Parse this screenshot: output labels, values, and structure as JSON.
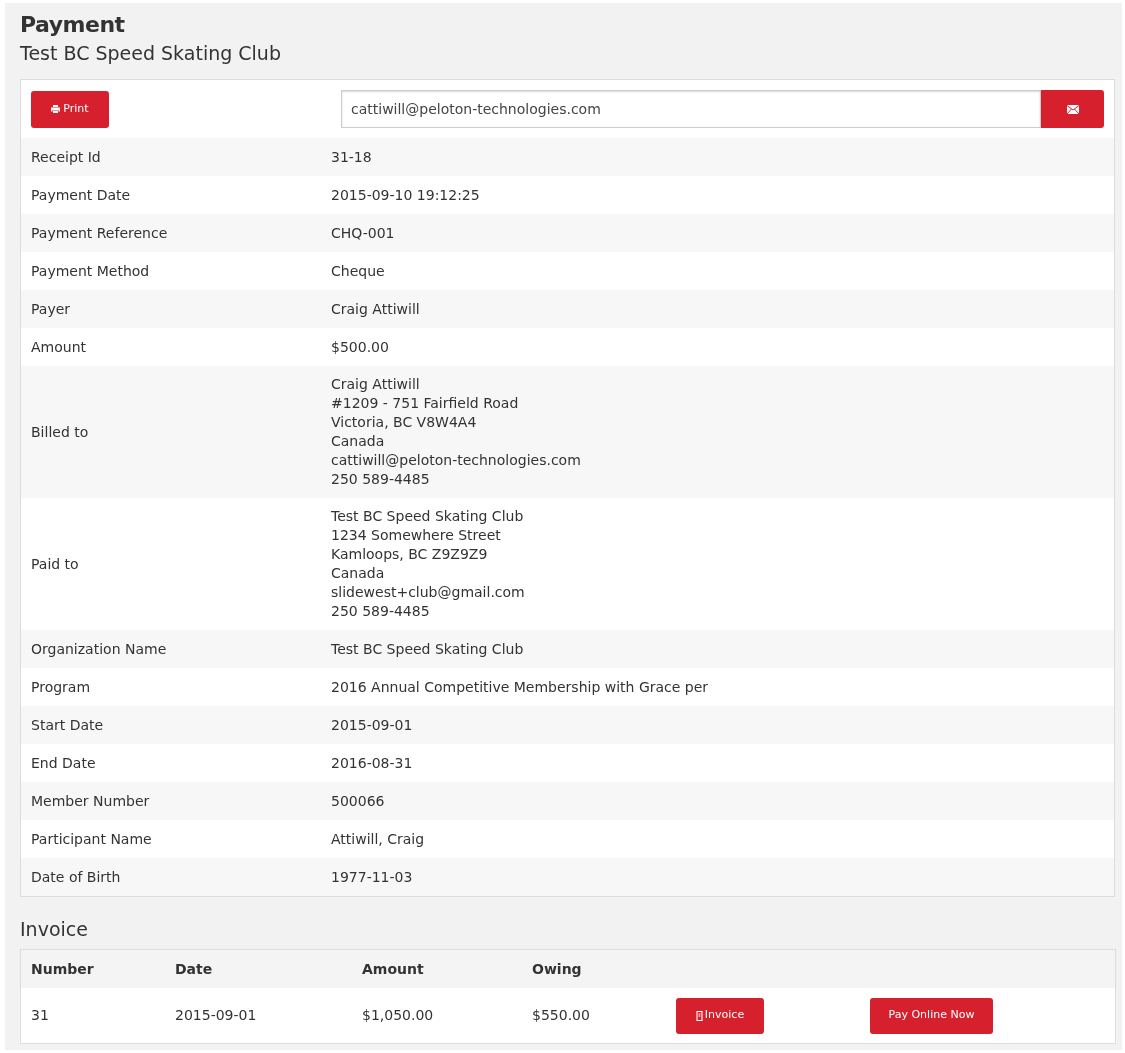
{
  "title": "Payment",
  "subtitle": "Test BC Speed Skating Club",
  "toolbar": {
    "print_button": "Print",
    "email_field": {
      "value": "cattiwill@peloton-technologies.com"
    }
  },
  "details": [
    {
      "label": "Receipt Id",
      "lines": [
        "31-18"
      ]
    },
    {
      "label": "Payment Date",
      "lines": [
        "2015-09-10 19:12:25"
      ]
    },
    {
      "label": "Payment Reference",
      "lines": [
        "CHQ-001"
      ]
    },
    {
      "label": "Payment Method",
      "lines": [
        "Cheque"
      ]
    },
    {
      "label": "Payer",
      "lines": [
        "Craig Attiwill"
      ]
    },
    {
      "label": "Amount",
      "lines": [
        "$500.00"
      ]
    },
    {
      "label": "Billed to",
      "lines": [
        "Craig Attiwill",
        "#1209 - 751 Fairfield Road",
        "Victoria, BC V8W4A4",
        "Canada",
        "cattiwill@peloton-technologies.com",
        "250 589-4485"
      ]
    },
    {
      "label": "Paid to",
      "lines": [
        "Test BC Speed Skating Club",
        "1234 Somewhere Street",
        "Kamloops, BC Z9Z9Z9",
        "Canada",
        "slidewest+club@gmail.com",
        "250 589-4485"
      ]
    },
    {
      "label": "Organization Name",
      "lines": [
        "Test BC Speed Skating Club"
      ]
    },
    {
      "label": "Program",
      "lines": [
        "2016 Annual Competitive Membership with Grace per"
      ]
    },
    {
      "label": "Start Date",
      "lines": [
        "2015-09-01"
      ]
    },
    {
      "label": "End Date",
      "lines": [
        "2016-08-31"
      ]
    },
    {
      "label": "Member Number",
      "lines": [
        "500066"
      ]
    },
    {
      "label": "Participant Name",
      "lines": [
        "Attiwill, Craig"
      ]
    },
    {
      "label": "Date of Birth",
      "lines": [
        "1977-11-03"
      ]
    }
  ],
  "invoice": {
    "heading": "Invoice",
    "columns": [
      "Number",
      "Date",
      "Amount",
      "Owing"
    ],
    "rows": [
      {
        "cells": [
          "31",
          "2015-09-01",
          "$1,050.00",
          "$550.00"
        ],
        "invoice_button": "Invoice",
        "pay_button": "Pay Online Now"
      }
    ]
  }
}
